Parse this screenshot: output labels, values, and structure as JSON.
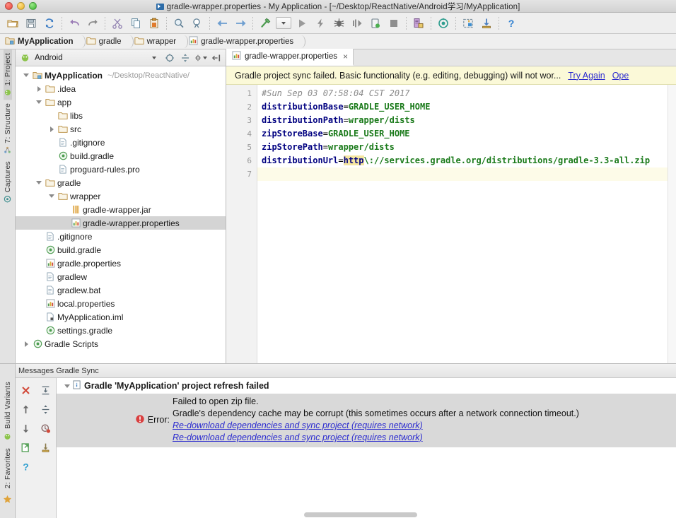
{
  "window": {
    "title": "gradle-wrapper.properties - My Application - [~/Desktop/ReactNative/Android学习/MyApplication]",
    "controls": [
      "close",
      "minimize",
      "zoom"
    ]
  },
  "toolbar": {
    "buttons": [
      {
        "name": "open-folder-icon",
        "tip": "Open"
      },
      {
        "name": "save-all-icon",
        "tip": "Save All"
      },
      {
        "name": "sync-icon",
        "tip": "Synchronize"
      },
      {
        "name": "undo-icon",
        "tip": "Undo"
      },
      {
        "name": "redo-icon",
        "tip": "Redo"
      },
      {
        "name": "cut-icon",
        "tip": "Cut"
      },
      {
        "name": "copy-icon",
        "tip": "Copy"
      },
      {
        "name": "paste-icon",
        "tip": "Paste"
      },
      {
        "name": "find-icon",
        "tip": "Find"
      },
      {
        "name": "replace-icon",
        "tip": "Replace"
      },
      {
        "name": "back-icon",
        "tip": "Back"
      },
      {
        "name": "forward-icon",
        "tip": "Forward"
      },
      {
        "name": "build-hammer-icon",
        "tip": "Make Project"
      },
      {
        "name": "run-config-dropdown",
        "tip": "Select Run/Debug Configuration"
      },
      {
        "name": "run-icon",
        "tip": "Run"
      },
      {
        "name": "debug-icon",
        "tip": "Debug"
      },
      {
        "name": "attach-debugger-icon",
        "tip": "Attach debugger"
      },
      {
        "name": "instant-run-icon",
        "tip": "Apply Changes"
      },
      {
        "name": "profile-icon",
        "tip": "Profile"
      },
      {
        "name": "stop-icon",
        "tip": "Stop"
      },
      {
        "name": "sdk-manager-icon",
        "tip": "SDK Manager"
      },
      {
        "name": "avd-manager-icon",
        "tip": "AVD Manager"
      },
      {
        "name": "layout-inspector-icon",
        "tip": "Layout Inspector"
      },
      {
        "name": "sync-gradle-icon",
        "tip": "Sync Project with Gradle Files"
      },
      {
        "name": "help-icon",
        "tip": "Help"
      }
    ]
  },
  "breadcrumb": [
    {
      "label": "MyApplication",
      "icon": "project-folder-icon",
      "bold": true
    },
    {
      "label": "gradle",
      "icon": "folder-icon",
      "bold": false
    },
    {
      "label": "wrapper",
      "icon": "folder-icon",
      "bold": false
    },
    {
      "label": "gradle-wrapper.properties",
      "icon": "properties-file-icon",
      "bold": false
    }
  ],
  "left_tool_tabs": [
    {
      "label": "1: Project",
      "icon": "android-icon",
      "active": true
    },
    {
      "label": "7: Structure",
      "icon": "structure-icon",
      "active": false
    },
    {
      "label": "Captures",
      "icon": "captures-icon",
      "active": false
    }
  ],
  "left_tool_tabs_bottom": [
    {
      "label": "Build Variants",
      "icon": "android-icon",
      "active": false
    },
    {
      "label": "2: Favorites",
      "icon": "star-icon",
      "active": false
    }
  ],
  "project_panel": {
    "view_selector": {
      "label": "Android",
      "icon": "android-icon"
    },
    "header_buttons": [
      {
        "name": "target-scroll-from-source-icon"
      },
      {
        "name": "collapse-all-icon"
      },
      {
        "name": "settings-gear-icon"
      },
      {
        "name": "hide-panel-icon"
      }
    ],
    "tree": [
      {
        "label": "MyApplication",
        "path": "~/Desktop/ReactNative/",
        "indent": 0,
        "arrow": "expanded",
        "icon": "project-folder-icon",
        "bold": true,
        "selected": false
      },
      {
        "label": ".idea",
        "path": "",
        "indent": 1,
        "arrow": "collapsed",
        "icon": "folder-icon",
        "bold": false,
        "selected": false
      },
      {
        "label": "app",
        "path": "",
        "indent": 1,
        "arrow": "expanded",
        "icon": "folder-icon",
        "bold": false,
        "selected": false
      },
      {
        "label": "libs",
        "path": "",
        "indent": 2,
        "arrow": "none",
        "icon": "folder-icon",
        "bold": false,
        "selected": false
      },
      {
        "label": "src",
        "path": "",
        "indent": 2,
        "arrow": "collapsed",
        "icon": "folder-icon",
        "bold": false,
        "selected": false
      },
      {
        "label": ".gitignore",
        "path": "",
        "indent": 2,
        "arrow": "none",
        "icon": "text-file-icon",
        "bold": false,
        "selected": false
      },
      {
        "label": "build.gradle",
        "path": "",
        "indent": 2,
        "arrow": "none",
        "icon": "gradle-file-icon",
        "bold": false,
        "selected": false
      },
      {
        "label": "proguard-rules.pro",
        "path": "",
        "indent": 2,
        "arrow": "none",
        "icon": "text-file-icon",
        "bold": false,
        "selected": false
      },
      {
        "label": "gradle",
        "path": "",
        "indent": 1,
        "arrow": "expanded",
        "icon": "folder-icon",
        "bold": false,
        "selected": false
      },
      {
        "label": "wrapper",
        "path": "",
        "indent": 2,
        "arrow": "expanded",
        "icon": "folder-icon",
        "bold": false,
        "selected": false
      },
      {
        "label": "gradle-wrapper.jar",
        "path": "",
        "indent": 3,
        "arrow": "none",
        "icon": "jar-file-icon",
        "bold": false,
        "selected": false
      },
      {
        "label": "gradle-wrapper.properties",
        "path": "",
        "indent": 3,
        "arrow": "none",
        "icon": "properties-file-icon",
        "bold": false,
        "selected": true
      },
      {
        "label": ".gitignore",
        "path": "",
        "indent": 1,
        "arrow": "none",
        "icon": "text-file-icon",
        "bold": false,
        "selected": false
      },
      {
        "label": "build.gradle",
        "path": "",
        "indent": 1,
        "arrow": "none",
        "icon": "gradle-file-icon",
        "bold": false,
        "selected": false
      },
      {
        "label": "gradle.properties",
        "path": "",
        "indent": 1,
        "arrow": "none",
        "icon": "properties-file-icon",
        "bold": false,
        "selected": false
      },
      {
        "label": "gradlew",
        "path": "",
        "indent": 1,
        "arrow": "none",
        "icon": "text-file-icon",
        "bold": false,
        "selected": false
      },
      {
        "label": "gradlew.bat",
        "path": "",
        "indent": 1,
        "arrow": "none",
        "icon": "text-file-icon",
        "bold": false,
        "selected": false
      },
      {
        "label": "local.properties",
        "path": "",
        "indent": 1,
        "arrow": "none",
        "icon": "properties-file-icon",
        "bold": false,
        "selected": false
      },
      {
        "label": "MyApplication.iml",
        "path": "",
        "indent": 1,
        "arrow": "none",
        "icon": "iml-file-icon",
        "bold": false,
        "selected": false
      },
      {
        "label": "settings.gradle",
        "path": "",
        "indent": 1,
        "arrow": "none",
        "icon": "gradle-file-icon",
        "bold": false,
        "selected": false
      },
      {
        "label": "Gradle Scripts",
        "path": "",
        "indent": 0,
        "arrow": "collapsed",
        "icon": "gradle-file-icon",
        "bold": false,
        "selected": false
      }
    ]
  },
  "editor": {
    "tabs": [
      {
        "label": "gradle-wrapper.properties",
        "icon": "properties-file-icon",
        "close": "×",
        "active": true
      }
    ],
    "notification": {
      "message": "Gradle project sync failed. Basic functionality (e.g. editing, debugging) will not wor...",
      "links": [
        "Try Again",
        "Ope"
      ]
    },
    "line_numbers": [
      "1",
      "2",
      "3",
      "4",
      "5",
      "6",
      "7"
    ],
    "lines": [
      {
        "n": 1,
        "type": "comment",
        "text": "#Sun Sep 03 07:58:04 CST 2017"
      },
      {
        "n": 2,
        "type": "prop",
        "key": "distributionBase",
        "value": "GRADLE_USER_HOME"
      },
      {
        "n": 3,
        "type": "prop",
        "key": "distributionPath",
        "value": "wrapper/dists"
      },
      {
        "n": 4,
        "type": "prop",
        "key": "zipStoreBase",
        "value": "GRADLE_USER_HOME"
      },
      {
        "n": 5,
        "type": "prop",
        "key": "zipStorePath",
        "value": "wrapper/dists"
      },
      {
        "n": 6,
        "type": "url",
        "key": "distributionUrl",
        "highlight": "http",
        "value": "\\://services.gradle.org/distributions/gradle-3.3-all.zip"
      },
      {
        "n": 7,
        "type": "empty",
        "text": ""
      }
    ]
  },
  "messages_panel": {
    "title": "Messages Gradle Sync",
    "tool_buttons": [
      {
        "name": "close-messages-icon"
      },
      {
        "name": "expand-all-icon"
      },
      {
        "name": "scroll-up-icon"
      },
      {
        "name": "collapse-all-icon"
      },
      {
        "name": "scroll-down-icon"
      },
      {
        "name": "filter-errors-icon"
      },
      {
        "name": "export-icon"
      },
      {
        "name": "pin-icon"
      },
      {
        "name": "help-icon"
      }
    ],
    "root": {
      "label": "Gradle 'MyApplication' project refresh failed",
      "icon": "info-icon",
      "arrow": "expanded"
    },
    "error": {
      "label": "Error:",
      "icon": "error-icon",
      "lines": [
        "Failed to open zip file.",
        "Gradle's dependency cache may be corrupt (this sometimes occurs after a network connection timeout.)"
      ],
      "links": [
        "Re-download dependencies and sync project (requires network)",
        "Re-download dependencies and sync project (requires network)"
      ]
    }
  },
  "colors": {
    "notification_bg": "#fbf9d8",
    "link": "#2b2bcf",
    "error_red": "#d94040",
    "selection_gray": "#d4d4d4",
    "key_blue": "#000080",
    "value_green": "#1a7a1a",
    "highlight_yellow": "#f5e6a0"
  }
}
